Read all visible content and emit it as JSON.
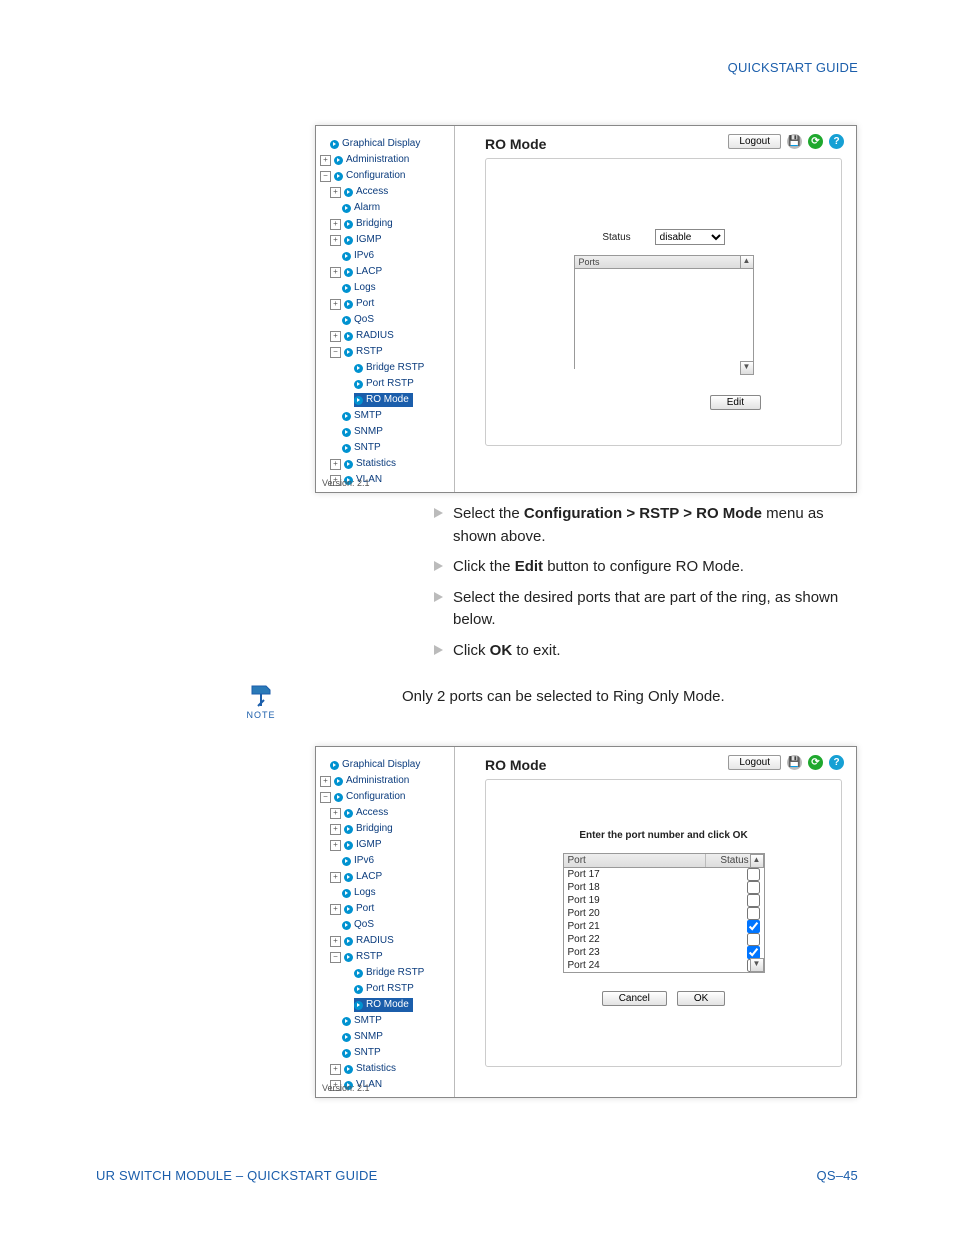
{
  "header": {
    "quickstart": "QUICKSTART GUIDE"
  },
  "footer": {
    "left": "UR SWITCH MODULE – QUICKSTART GUIDE",
    "right": "QS–45"
  },
  "instructions": {
    "i1a": "Select the ",
    "i1b": "Configuration > RSTP > RO Mode",
    "i1c": " menu as shown above.",
    "i2a": " Click the ",
    "i2b": "Edit",
    "i2c": " button to configure RO Mode.",
    "i3": "Select the desired ports that are part of the ring, as shown below.",
    "i4a": " Click ",
    "i4b": "OK",
    "i4c": " to exit."
  },
  "note": {
    "label": "NOTE",
    "text": "Only 2 ports can be selected to Ring Only Mode."
  },
  "shot1": {
    "title": "RO Mode",
    "logout": "Logout",
    "status_label": "Status",
    "status_value": "disable",
    "ports_header": "Ports",
    "edit": "Edit",
    "version": "Version:  2.1",
    "tree": {
      "graphical": "Graphical Display",
      "admin": "Administration",
      "config": "Configuration",
      "access": "Access",
      "alarm": "Alarm",
      "bridging": "Bridging",
      "igmp": "IGMP",
      "ipv6": "IPv6",
      "lacp": "LACP",
      "logs": "Logs",
      "port": "Port",
      "qos": "QoS",
      "radius": "RADIUS",
      "rstp": "RSTP",
      "bridge_rstp": "Bridge RSTP",
      "port_rstp": "Port RSTP",
      "ro_mode": "RO Mode",
      "smtp": "SMTP",
      "snmp": "SNMP",
      "sntp": "SNTP",
      "statistics": "Statistics",
      "vlan": "VLAN"
    }
  },
  "shot2": {
    "title": "RO Mode",
    "logout": "Logout",
    "hint": "Enter the port number and click OK",
    "th_port": "Port",
    "th_status": "Status",
    "p17": "Port 17",
    "p18": "Port 18",
    "p19": "Port 19",
    "p20": "Port 20",
    "p21": "Port 21",
    "p22": "Port 22",
    "p23": "Port 23",
    "p24": "Port 24",
    "cancel": "Cancel",
    "ok": "OK",
    "version": "Version:  2.1"
  }
}
